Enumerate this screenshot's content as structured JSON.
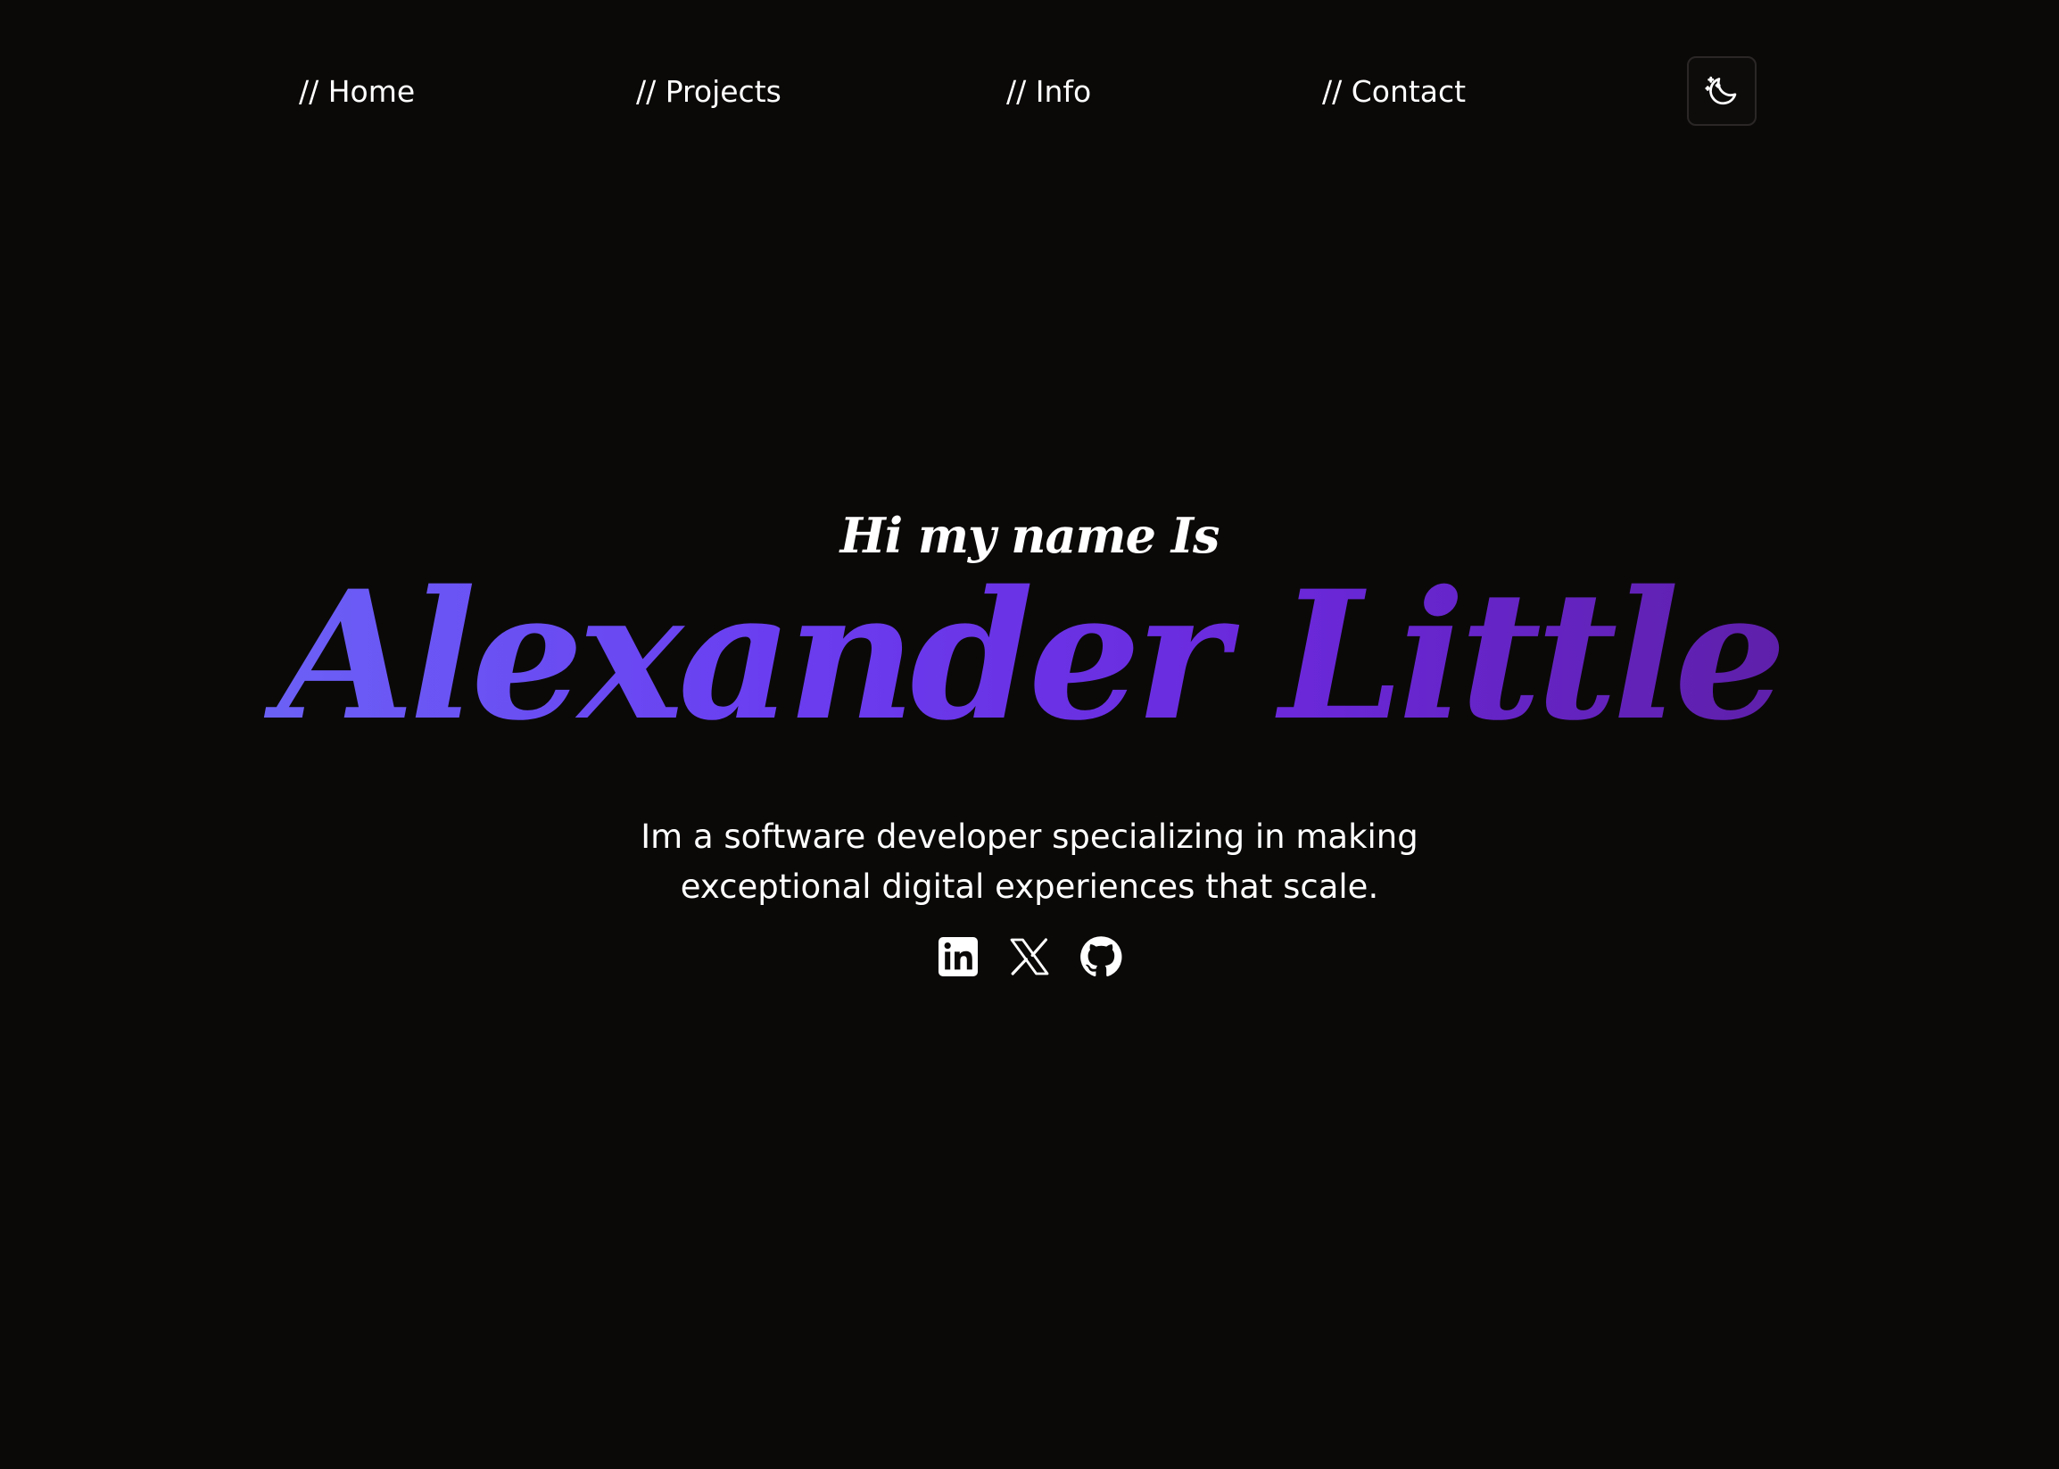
{
  "nav": {
    "items": [
      {
        "label": "// Home"
      },
      {
        "label": "// Projects"
      },
      {
        "label": "// Info"
      },
      {
        "label": "// Contact"
      }
    ],
    "theme_toggle_icon": "moon-stars-icon"
  },
  "hero": {
    "greeting": "Hi my name Is",
    "name": "Alexander Little",
    "tagline_line1": "Im a software developer specializing in making",
    "tagline_line2": "exceptional digital experiences that scale.",
    "name_gradient": [
      "#6b61f6",
      "#6a3ef0",
      "#6a28da",
      "#5e1fa8"
    ]
  },
  "socials": [
    {
      "icon": "linkedin-icon"
    },
    {
      "icon": "x-twitter-icon"
    },
    {
      "icon": "github-icon"
    }
  ],
  "colors": {
    "background": "#0b0908",
    "text": "#ffffff"
  }
}
